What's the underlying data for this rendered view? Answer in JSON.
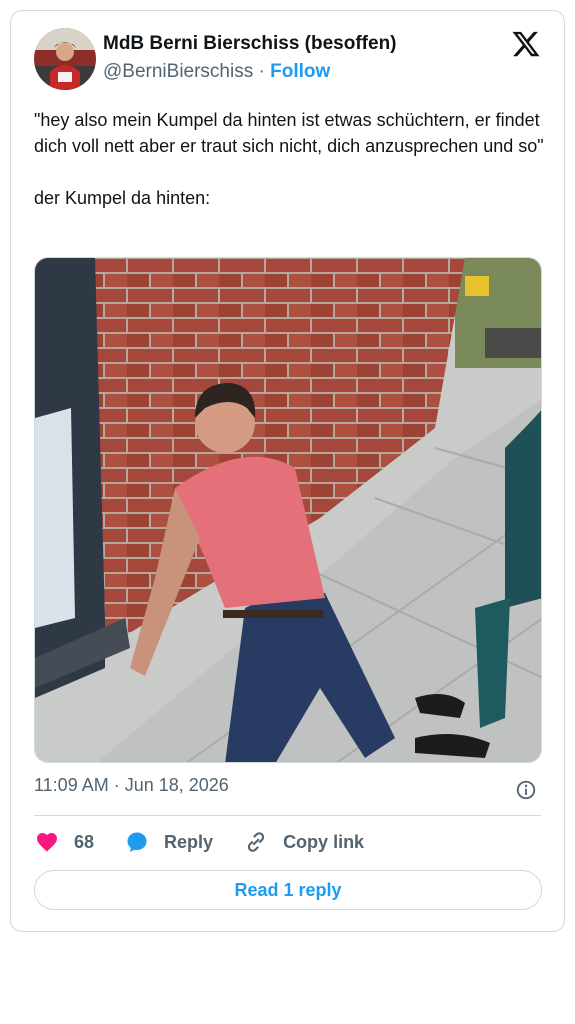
{
  "author": {
    "display_name": "MdB Berni Bierschiss (besoffen)",
    "handle": "@BerniBierschiss",
    "separator": "·",
    "follow_label": "Follow",
    "avatar_icon": "avatar-photo"
  },
  "brand": {
    "logo": "x-logo-icon",
    "color": "#0f1419"
  },
  "tweet": {
    "lines": [
      "\"hey also mein Kumpel da hinten ist etwas schüchtern, er findet dich voll nett aber er traut sich nicht, dich anzusprechen und so\"",
      "der Kumpel da hinten:"
    ]
  },
  "media": {
    "type": "photo"
  },
  "meta": {
    "timestamp": "11:09 AM · Jun 18, 2026",
    "info_icon": "info-icon"
  },
  "actions": {
    "like_count": "68",
    "reply_label": "Reply",
    "copy_label": "Copy link"
  },
  "read_reply_label": "Read 1 reply",
  "colors": {
    "accent": "#1d9bf0",
    "like": "#f91880",
    "muted": "#536471",
    "border": "#cfd9de"
  }
}
